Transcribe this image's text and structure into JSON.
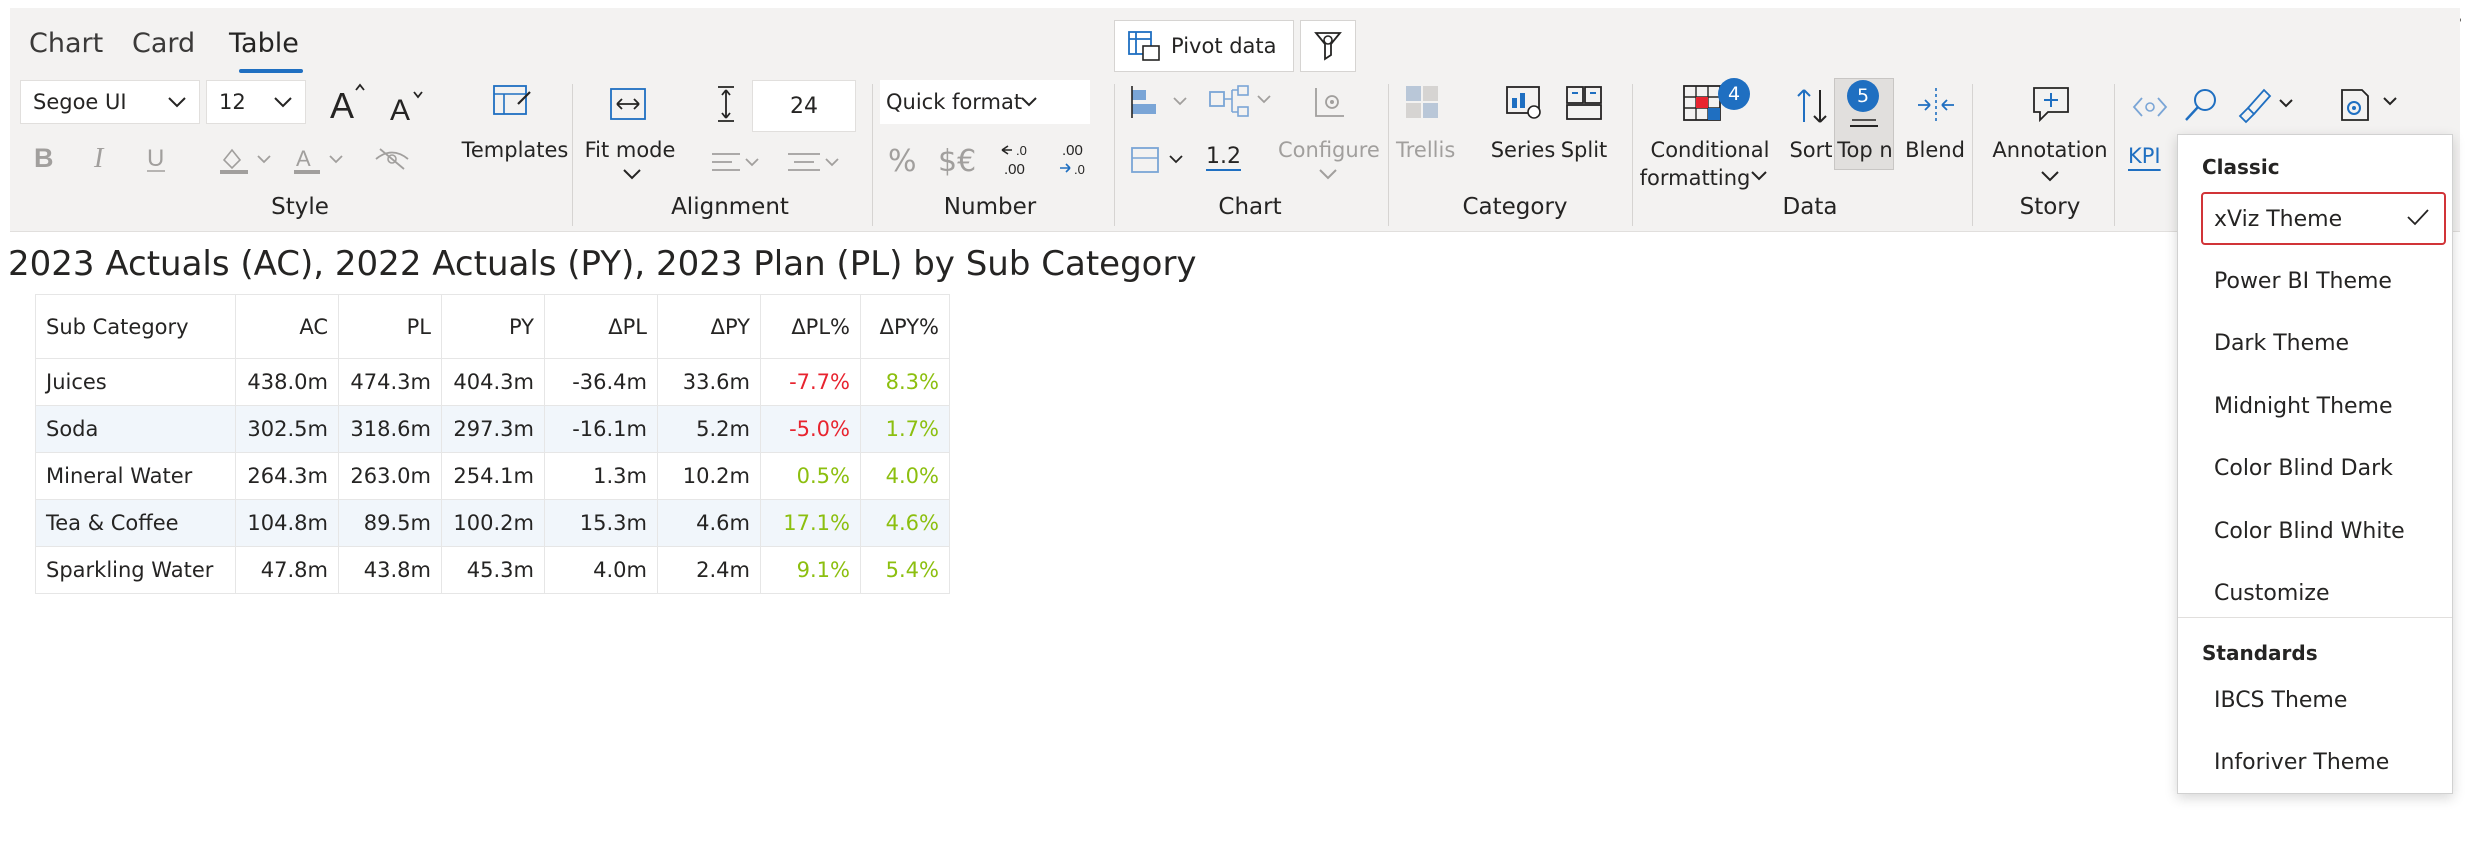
{
  "tabs": [
    {
      "label": "Chart"
    },
    {
      "label": "Card"
    },
    {
      "label": "Table"
    }
  ],
  "pivot": {
    "label": "Pivot data"
  },
  "style": {
    "font_family": "Segoe UI",
    "font_size": "12",
    "group_label": "Style",
    "templates_label": "Templates"
  },
  "alignment": {
    "fit_mode_label": "Fit mode",
    "row_height": "24",
    "group_label": "Alignment"
  },
  "number": {
    "quick_format": "Quick format",
    "percent_symbol": "%",
    "currency_symbol": "$€",
    "group_label": "Number"
  },
  "chart": {
    "scale_value": "1.2",
    "configure_label": "Configure",
    "group_label": "Chart"
  },
  "category": {
    "trellis_label": "Trellis",
    "series_label": "Series",
    "split_label": "Split",
    "group_label": "Category"
  },
  "data": {
    "conditional_label_1": "Conditional",
    "conditional_label_2": "formatting",
    "conditional_badge": "4",
    "sort_label": "Sort",
    "topn_label": "Top n",
    "topn_badge": "5",
    "blend_label": "Blend",
    "group_label": "Data"
  },
  "story": {
    "annotation_label": "Annotation",
    "group_label": "Story"
  },
  "extra": {
    "kpi_label": "KPI"
  },
  "visual": {
    "title": "2023 Actuals (AC), 2022 Actuals (PY), 2023 Plan (PL) by Sub Category"
  },
  "table": {
    "headers": [
      "Sub Category",
      "AC",
      "PL",
      "PY",
      "ΔPL",
      "ΔPY",
      "ΔPL%",
      "ΔPY%"
    ],
    "rows": [
      {
        "cells": [
          "Juices",
          "438.0m",
          "474.3m",
          "404.3m",
          "-36.4m",
          "33.6m",
          "-7.7%",
          "8.3%"
        ]
      },
      {
        "cells": [
          "Soda",
          "302.5m",
          "318.6m",
          "297.3m",
          "-16.1m",
          "5.2m",
          "-5.0%",
          "1.7%"
        ]
      },
      {
        "cells": [
          "Mineral Water",
          "264.3m",
          "263.0m",
          "254.1m",
          "1.3m",
          "10.2m",
          "0.5%",
          "4.0%"
        ]
      },
      {
        "cells": [
          "Tea & Coffee",
          "104.8m",
          "89.5m",
          "100.2m",
          "15.3m",
          "4.6m",
          "17.1%",
          "4.6%"
        ]
      },
      {
        "cells": [
          "Sparkling Water",
          "47.8m",
          "43.8m",
          "45.3m",
          "4.0m",
          "2.4m",
          "9.1%",
          "5.4%"
        ]
      }
    ]
  },
  "theme_menu": {
    "classic_header": "Classic",
    "classic_items": [
      "xViz Theme",
      "Power BI Theme",
      "Dark Theme",
      "Midnight Theme",
      "Color Blind Dark",
      "Color Blind White",
      "Customize"
    ],
    "selected": "xViz Theme",
    "standards_header": "Standards",
    "standards_items": [
      "IBCS Theme",
      "Inforiver Theme"
    ]
  },
  "colors": {
    "accent": "#1f6fc1",
    "negative": "#e8242f",
    "positive": "#8cbf0f",
    "selected_outline": "#d13438"
  }
}
